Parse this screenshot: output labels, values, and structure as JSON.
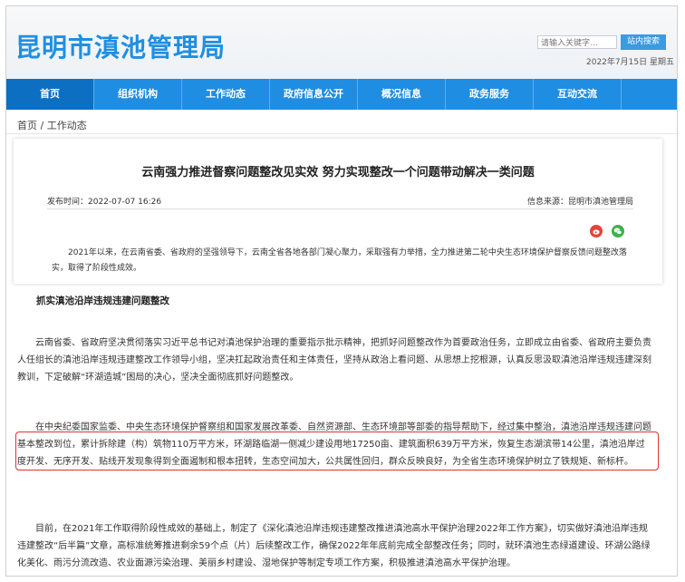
{
  "header": {
    "site_title": "昆明市滇池管理局",
    "search_placeholder": "请输入关键字…",
    "search_button": "站内搜索",
    "date": "2022年7月15日 星期五"
  },
  "nav": {
    "items": [
      {
        "label": "首页",
        "active": true
      },
      {
        "label": "组织机构"
      },
      {
        "label": "工作动态"
      },
      {
        "label": "政府信息公开"
      },
      {
        "label": "概况信息"
      },
      {
        "label": "政务服务"
      },
      {
        "label": "互动交流"
      }
    ]
  },
  "breadcrumb": "首页 / 工作动态",
  "article": {
    "title": "云南强力推进督察问题整改见实效 努力实现整改一个问题带动解决一类问题",
    "publish_time": "发布时间：2022-07-07 16:26",
    "source": "信息来源：昆明市滇池管理局",
    "share_icons": [
      "weibo-icon",
      "wechat-icon"
    ],
    "intro": "2021年以来，在云南省委、省政府的坚强领导下，云南全省各地各部门凝心聚力，采取强有力举措，全力推进第二轮中央生态环境保护督察反馈问题整改落实，取得了阶段性成效。",
    "section_heading": "抓实滇池沿岸违规违建问题整改",
    "paragraphs": [
      "云南省委、省政府坚决贯彻落实习近平总书记对滇池保护治理的重要指示批示精神，把抓好问题整改作为首要政治任务，立即成立由省委、省政府主要负责人任组长的滇池沿岸违规违建整改工作领导小组，坚决扛起政治责任和主体责任，坚持从政治上看问题、从思想上挖根源，认真反思汲取滇池沿岸违规违建深刻教训，下定破解“环湖造城”困局的决心，坚决全面彻底抓好问题整改。",
      "在中央纪委国家监委、中央生态环境保护督察组和国家发展改革委、自然资源部、生态环境部等部委的指导帮助下，经过集中整治，滇池沿岸违规违建问题基本整改到位，累计拆除建（构）筑物110万平方米，环湖路临湖一侧减少建设用地17250亩、建筑面积639万平方米，恢复生态湖滨带14公里，滇池沿岸过度开发、无序开发、贴线开发现象得到全面遏制和根本扭转，生态空间加大，公共属性回归，群众反映良好，为全省生态环境保护树立了铁规矩、新标杆。",
      "目前，在2021年工作取得阶段性成效的基础上，制定了《深化滇池沿岸违规违建整改推进滇池高水平保护治理2022年工作方案》，切实做好滇池沿岸违规违建整改“后半篇”文章，高标准统筹推进剩余59个点（片）后续整改工作，确保2022年年底前完成全部整改任务；同时，就环滇池生态绿道建设、环湖公路绿化美化、雨污分流改造、农业面源污染治理、美丽乡村建设、湿地保护等制定专项工作方案，积极推进滇池高水平保护治理。"
    ]
  },
  "colors": {
    "brand_blue": "#1f8fe1",
    "nav_bg": "#1f8de2",
    "highlight_red": "#e2312b"
  }
}
